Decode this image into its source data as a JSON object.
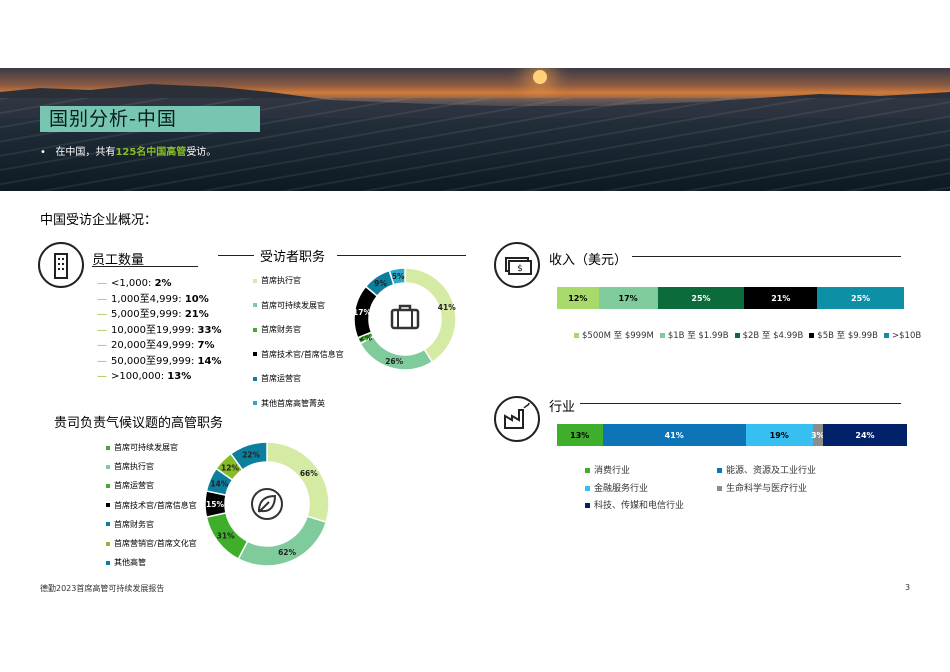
{
  "header": {
    "title": "国别分析-中国",
    "bullet_pre": "在中国，共有",
    "bullet_hl": "125名中国高管",
    "bullet_post": "受访。"
  },
  "overview_title": "中国受访企业概况：",
  "employees": {
    "title": "员工数量",
    "rows": [
      {
        "label": "<1,000: ",
        "value": "2%"
      },
      {
        "label": "1,000至4,999: ",
        "value": "10%"
      },
      {
        "label": "5,000至9,999: ",
        "value": "21%"
      },
      {
        "label": "10,000至19,999: ",
        "value": "33%"
      },
      {
        "label": "20,000至49,999: ",
        "value": "7%"
      },
      {
        "label": "50,000至99,999: ",
        "value": "14%"
      },
      {
        "label": ">100,000: ",
        "value": "13%"
      }
    ]
  },
  "roles": {
    "title": "受访者职务",
    "legend": [
      "首席执行官",
      "首席可持续发展官",
      "首席财务官",
      "首席技术官/首席信息官",
      "首席运营官",
      "其他首席高管菁英"
    ],
    "colors": [
      "#d5eba4",
      "#7fcb9b",
      "#3fae2a",
      "#000000",
      "#0d7f9e",
      "#2aa8c8"
    ],
    "values": [
      41,
      26,
      2,
      17,
      9,
      5
    ],
    "labels": [
      "41%",
      "26%",
      "2%",
      "17%",
      "9%",
      "5%"
    ]
  },
  "climate": {
    "title": "贵司负责气候议题的高管职务",
    "legend": [
      "首席可持续发展官",
      "首席执行官",
      "首席运营官",
      "首席技术官/首席信息官",
      "首席财务官",
      "首席营销官/首席文化官",
      "其他高管"
    ],
    "legend_colors": [
      "#3fae2a",
      "#7fcb9b",
      "#3fae2a",
      "#000000",
      "#0d7f9e",
      "#86bc25",
      "#0d7f9e"
    ],
    "colors": [
      "#d5eba4",
      "#7fcb9b",
      "#3fae2a",
      "#000000",
      "#0d7f9e",
      "#86bc25",
      "#0d7f9e"
    ],
    "values": [
      66,
      62,
      31,
      15,
      14,
      12,
      22
    ],
    "labels": [
      "66%",
      "62%",
      "31%",
      "15%",
      "14%",
      "12%",
      "22%"
    ]
  },
  "revenue": {
    "title": "收入（美元）",
    "segments": [
      {
        "label": "12%",
        "value": 12,
        "color": "#a8d96b",
        "text_color": "#000"
      },
      {
        "label": "17%",
        "value": 17,
        "color": "#7fcb9b",
        "text_color": "#000"
      },
      {
        "label": "25%",
        "value": 25,
        "color": "#0b6b3a",
        "text_color": "#fff"
      },
      {
        "label": "21%",
        "value": 21,
        "color": "#000000",
        "text_color": "#fff"
      },
      {
        "label": "25%",
        "value": 25,
        "color": "#0d8fa6",
        "text_color": "#fff"
      }
    ],
    "legend": [
      "$500M 至 $999M",
      "$1B 至 $1.99B",
      "$2B 至 $4.99B",
      "$5B 至 $9.99B",
      ">$10B"
    ]
  },
  "industry": {
    "title": "行业",
    "segments": [
      {
        "label": "13%",
        "value": 13,
        "color": "#3fae2a",
        "text_color": "#000"
      },
      {
        "label": "41%",
        "value": 41,
        "color": "#0d74b8",
        "text_color": "#fff"
      },
      {
        "label": "19%",
        "value": 19,
        "color": "#36bff0",
        "text_color": "#000"
      },
      {
        "label": "3%",
        "value": 3,
        "color": "#8c8c8c",
        "text_color": "#fff"
      },
      {
        "label": "24%",
        "value": 24,
        "color": "#012169",
        "text_color": "#fff"
      }
    ],
    "legend": [
      {
        "label": "消费行业",
        "color": "#3fae2a"
      },
      {
        "label": "能源、资源及工业行业",
        "color": "#0d74b8"
      },
      {
        "label": "金融服务行业",
        "color": "#36bff0"
      },
      {
        "label": "生命科学与医疗行业",
        "color": "#8c8c8c"
      },
      {
        "label": "科技、传媒和电信行业",
        "color": "#012169"
      }
    ]
  },
  "footer": {
    "text": "德勤2023首席高管可持续发展报告",
    "page": "3"
  }
}
